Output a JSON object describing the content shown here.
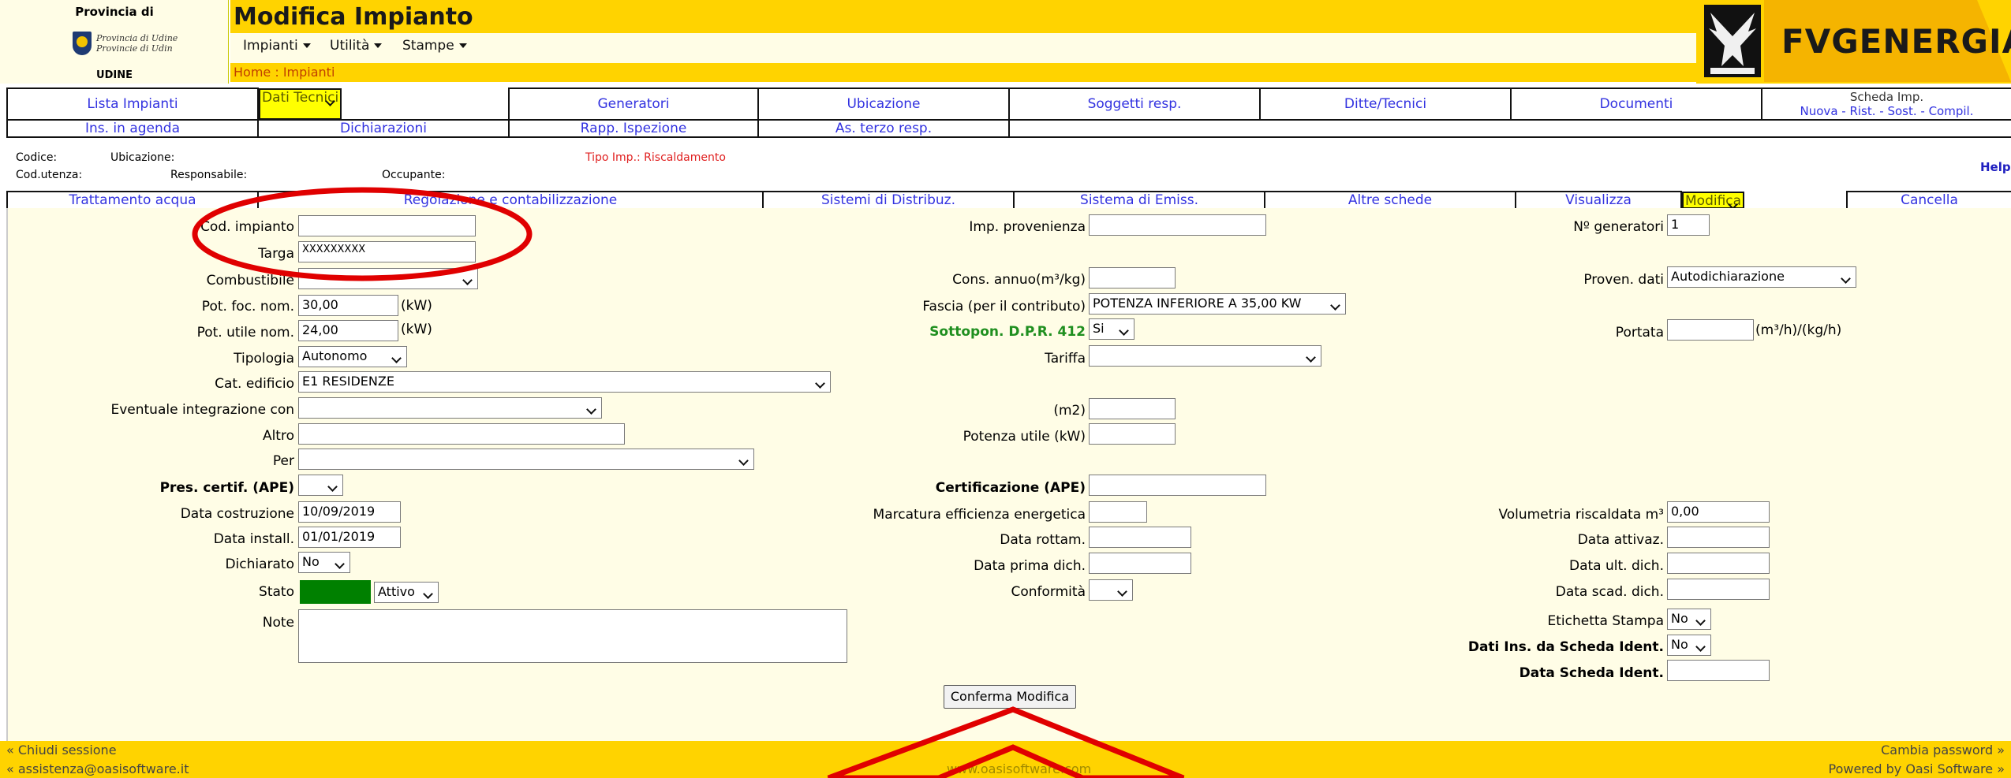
{
  "header": {
    "province_line1": "Provincia di",
    "province_seal_line1": "Provincia di Udine",
    "province_seal_line2": "Provincie di Udin",
    "province_line2": "UDINE",
    "title": "Modifica Impianto",
    "menu": [
      {
        "label": "Impianti"
      },
      {
        "label": "Utilità"
      },
      {
        "label": "Stampe"
      }
    ],
    "breadcrumb": "Home : Impianti",
    "logo_text": "FVGENERGIA",
    "accent": "#ffd300"
  },
  "nav_tabs_row1": [
    "Lista Impianti",
    "Dati Tecnici",
    "Generatori",
    "Ubicazione",
    "Soggetti resp.",
    "Ditte/Tecnici",
    "Documenti"
  ],
  "scheda": {
    "line1": "Scheda Imp.",
    "line2": "Nuova - Rist. - Sost. - Compil."
  },
  "nav_tabs_row2": [
    "Ins. in agenda",
    "Dichiarazioni",
    "Rapp. Ispezione",
    "As. terzo resp."
  ],
  "info": {
    "codice": "Codice:",
    "ubicazione": "Ubicazione:",
    "tipo": "Tipo Imp.: Riscaldamento",
    "cod_utenza": "Cod.utenza:",
    "responsabile": "Responsabile:",
    "occupante": "Occupante:",
    "help": "Help"
  },
  "nav_tabs_row3": [
    "Trattamento acqua",
    "Regolazione e contabilizzazione",
    "Sistemi di Distribuz.",
    "Sistema di Emiss.",
    "Altre schede",
    "Visualizza",
    "Modifica",
    "Cancella"
  ],
  "form": {
    "cod_impianto": {
      "label": "Cod. impianto",
      "value": ""
    },
    "targa": {
      "label": "Targa",
      "value": "XXXXXXXXX"
    },
    "combustibile": {
      "label": "Combustibile",
      "value": ""
    },
    "pot_foc": {
      "label": "Pot. foc. nom.",
      "value": "30,00",
      "unit": "(kW)"
    },
    "pot_utile": {
      "label": "Pot. utile nom.",
      "value": "24,00",
      "unit": "(kW)"
    },
    "tipologia": {
      "label": "Tipologia",
      "value": "Autonomo"
    },
    "cat_edificio": {
      "label": "Cat. edificio",
      "value": "E1 RESIDENZE"
    },
    "integrazione": {
      "label": "Eventuale integrazione con",
      "value": ""
    },
    "altro": {
      "label": "Altro",
      "value": ""
    },
    "per": {
      "label": "Per",
      "value": ""
    },
    "pres_certif": {
      "label": "Pres. certif. (APE)",
      "value": ""
    },
    "data_costruzione": {
      "label": "Data costruzione",
      "value": "10/09/2019"
    },
    "data_install": {
      "label": "Data install.",
      "value": "01/01/2019"
    },
    "dichiarato": {
      "label": "Dichiarato",
      "value": "No"
    },
    "stato": {
      "label": "Stato",
      "value": "Attivo",
      "color": "#008000"
    },
    "note": {
      "label": "Note",
      "value": ""
    },
    "imp_provenienza": {
      "label": "Imp. provenienza",
      "value": ""
    },
    "cons_annuo": {
      "label": "Cons. annuo(m³/kg)",
      "value": ""
    },
    "fascia": {
      "label": "Fascia (per il contributo)",
      "value": "POTENZA INFERIORE A 35,00 KW"
    },
    "sottopon": {
      "label": "Sottopon. D.P.R. 412",
      "value": "Si"
    },
    "tariffa": {
      "label": "Tariffa",
      "value": ""
    },
    "m2": {
      "label": "(m2)",
      "value": ""
    },
    "potenza_utile": {
      "label": "Potenza utile (kW)",
      "value": ""
    },
    "certificazione": {
      "label": "Certificazione (APE)",
      "value": ""
    },
    "marcatura": {
      "label": "Marcatura efficienza energetica",
      "value": ""
    },
    "data_rottam": {
      "label": "Data rottam.",
      "value": ""
    },
    "data_prima_dich": {
      "label": "Data prima dich.",
      "value": ""
    },
    "conformita": {
      "label": "Conformità",
      "value": ""
    },
    "n_generatori": {
      "label": "Nº generatori",
      "value": "1"
    },
    "proven_dati": {
      "label": "Proven. dati",
      "value": "Autodichiarazione"
    },
    "portata": {
      "label": "Portata",
      "value": "",
      "unit": "(m³/h)/(kg/h)"
    },
    "volumetria": {
      "label": "Volumetria riscaldata m³",
      "value": "0,00"
    },
    "data_attivaz": {
      "label": "Data attivaz.",
      "value": ""
    },
    "data_ult_dich": {
      "label": "Data ult. dich.",
      "value": ""
    },
    "data_scad_dich": {
      "label": "Data scad. dich.",
      "value": ""
    },
    "etichetta": {
      "label": "Etichetta Stampa",
      "value": "No"
    },
    "dati_ins": {
      "label": "Dati Ins. da Scheda Ident.",
      "value": "No"
    },
    "data_scheda": {
      "label": "Data Scheda Ident.",
      "value": ""
    },
    "confirm": "Conferma Modifica"
  },
  "footer": {
    "chiudi": "« Chiudi sessione",
    "cambia": "Cambia password »",
    "email": "« assistenza@oasisoftware.it",
    "site": "www.oasisoftware.com",
    "powered": "Powered by Oasi Software »"
  },
  "annotation_color": "#e00000"
}
